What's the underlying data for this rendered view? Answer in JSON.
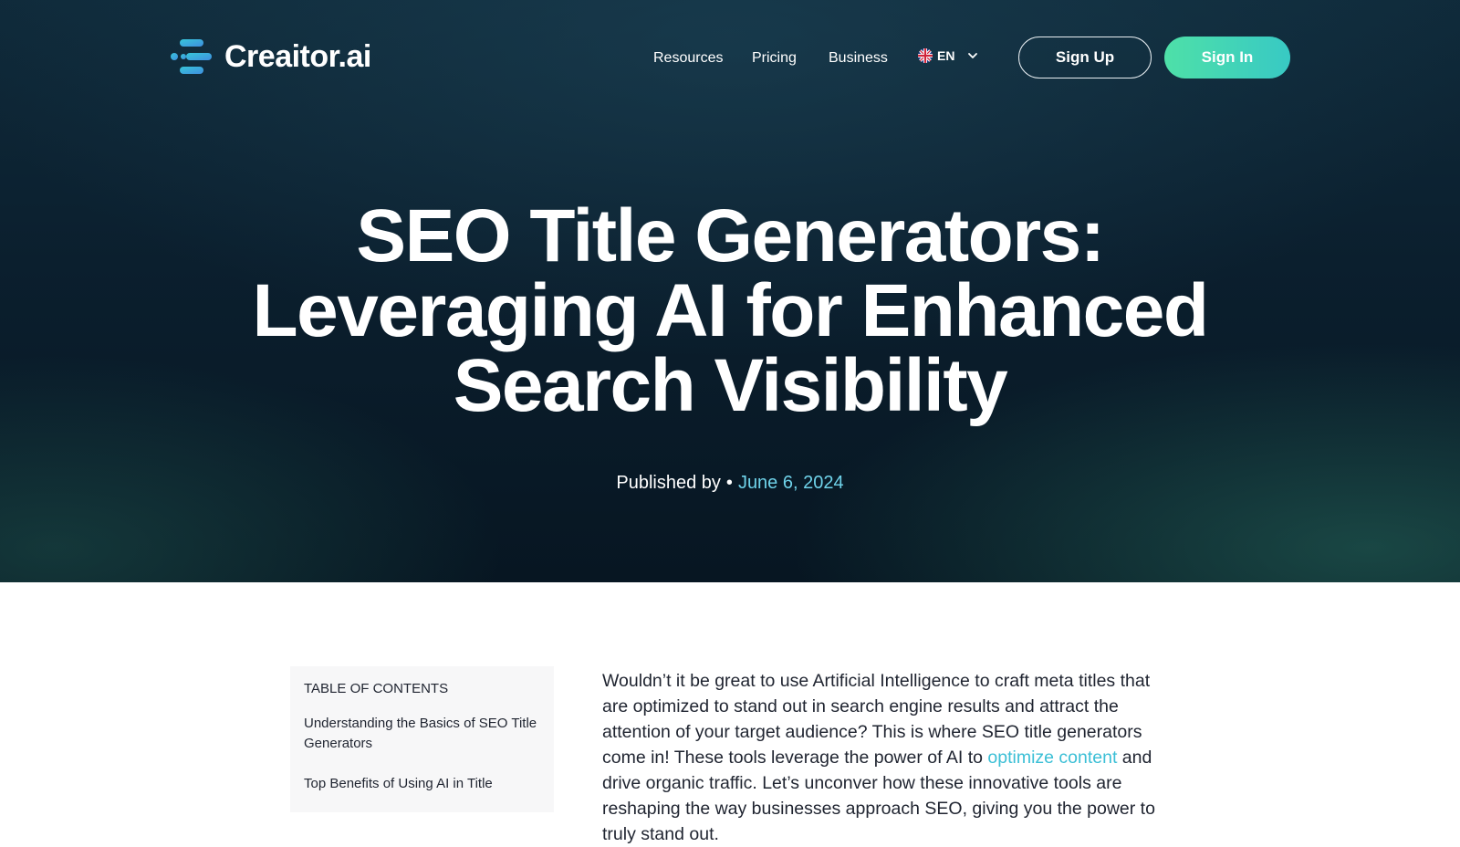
{
  "nav": {
    "brand": "Creaitor.ai",
    "links": [
      {
        "label": "Resources"
      },
      {
        "label": "Pricing"
      },
      {
        "label": "Business"
      }
    ],
    "language": {
      "code": "EN",
      "flag_icon": "uk-flag-icon"
    },
    "signup_label": "Sign Up",
    "signin_label": "Sign In"
  },
  "hero": {
    "title_lines": [
      "SEO Title Generators:",
      "Leveraging AI for Enhanced",
      "Search Visibility"
    ],
    "published_by": "Published by",
    "separator": "•",
    "date": "June 6, 2024"
  },
  "toc": {
    "heading": "TABLE OF CONTENTS",
    "items": [
      "Understanding the Basics of SEO Title Generators",
      "Top Benefits of Using AI in Title"
    ]
  },
  "article": {
    "p1_before": "Wouldn’t it be great to use Artificial Intelligence to craft meta titles that are optimized to stand out in search engine results and attract the attention of your target audience? This is where SEO title generators come in! These tools leverage the power of AI to ",
    "p1_link": "optimize content",
    "p1_after": " and drive organic traffic. Let’s unconver how these innovative tools are reshaping the way businesses approach SEO, giving you the power to truly stand out."
  },
  "colors": {
    "accent": "#3bbfd6",
    "signin_gradient_start": "#4ee0a8",
    "signin_gradient_end": "#38c9c4",
    "hero_bg": "#0b1f2e"
  }
}
